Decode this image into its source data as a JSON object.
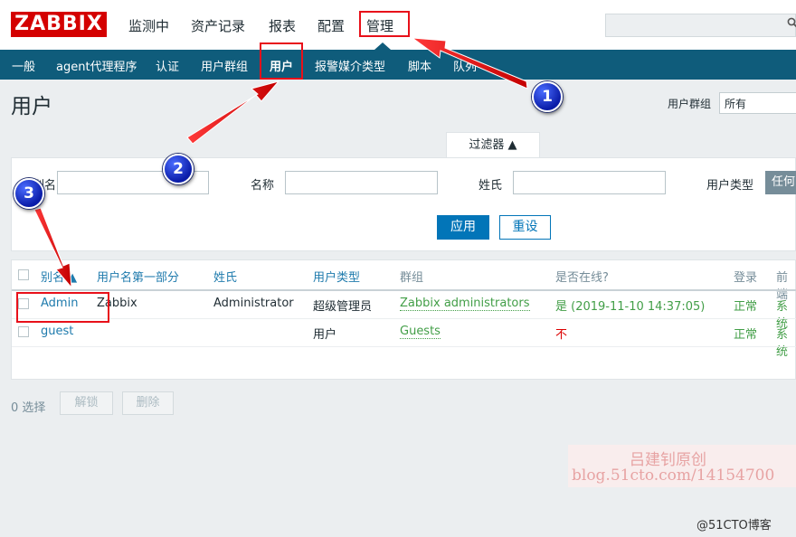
{
  "header": {
    "logo": "ZABBIX",
    "menu": [
      "监测中",
      "资产记录",
      "报表",
      "配置",
      "管理"
    ]
  },
  "submenu": [
    "一般",
    "agent代理程序",
    "认证",
    "用户群组",
    "用户",
    "报警媒介类型",
    "脚本",
    "队列"
  ],
  "page": {
    "title": "用户",
    "group_label": "用户群组",
    "group_value": "所有"
  },
  "filter": {
    "tab_label": "过滤器 ▲",
    "alias_label": "别名",
    "alias_value": "",
    "name_label": "名称",
    "name_value": "",
    "surname_label": "姓氏",
    "surname_value": "",
    "type_label": "用户类型",
    "type_value": "任何",
    "apply": "应用",
    "reset": "重设"
  },
  "table": {
    "columns": [
      "别名 ▲",
      "用户名第一部分",
      "姓氏",
      "用户类型",
      "群组",
      "是否在线?",
      "登录",
      "前端"
    ],
    "rows": [
      {
        "alias": "Admin",
        "name": "Zabbix",
        "surname": "Administrator",
        "type": "超级管理员",
        "group": "Zabbix administrators",
        "online": "是 (2019-11-10 14:37:05)",
        "login": "正常",
        "frontend": "系统"
      },
      {
        "alias": "guest",
        "name": "",
        "surname": "",
        "type": "用户",
        "group": "Guests",
        "online": "不",
        "login": "正常",
        "frontend": "系统"
      }
    ]
  },
  "actions": {
    "selected": "0 选择",
    "unlock": "解锁",
    "delete": "删除"
  },
  "annotations": {
    "step1": "1",
    "step2": "2",
    "step3": "3",
    "arrow_color": "#e8101a"
  },
  "watermark": {
    "line1": "吕建钊原创",
    "line2": "blog.51cto.com/14154700",
    "corner": "@51CTO博客"
  },
  "colors": {
    "brand": "#d40000",
    "submenu_bg": "#0f5c7b",
    "link": "#1f7bad",
    "ok_green": "#429e47",
    "no_red": "#dc0000",
    "primary_button": "#0275b8"
  }
}
